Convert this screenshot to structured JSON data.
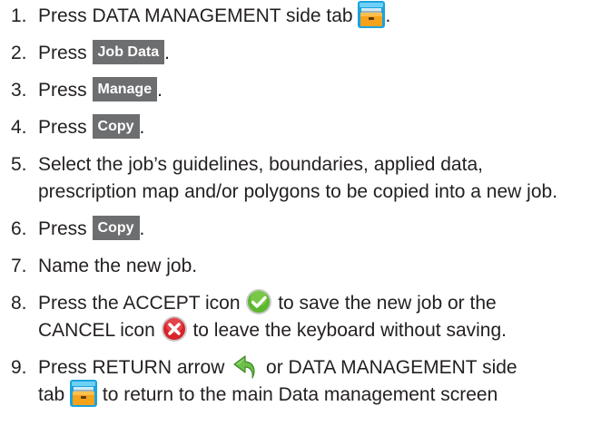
{
  "steps": [
    {
      "num": "1.",
      "before": "Press DATA MANAGEMENT side tab ",
      "after": "."
    },
    {
      "num": "2.",
      "before": "Press ",
      "button": "Job Data",
      "after": "."
    },
    {
      "num": "3.",
      "before": "Press ",
      "button": "Manage",
      "after": "."
    },
    {
      "num": "4.",
      "before": "Press ",
      "button": "Copy",
      "after": "."
    },
    {
      "num": "5.",
      "line1": "Select the job’s guidelines, boundaries, applied data,",
      "line2": "prescription map and/or polygons to be copied into a new job."
    },
    {
      "num": "6.",
      "before": "Press ",
      "button": "Copy",
      "after": "."
    },
    {
      "num": "7.",
      "text": "Name the new job."
    },
    {
      "num": "8.",
      "l1_before": "Press the ACCEPT icon ",
      "l1_after": " to save the new job or the",
      "l2_before": "CANCEL icon ",
      "l2_after": " to leave the keyboard without saving."
    },
    {
      "num": "9.",
      "l1_before": "Press RETURN arrow ",
      "l1_after": " or DATA MANAGEMENT side",
      "l2_before": "tab ",
      "l2_after": " to return to the main Data management screen"
    }
  ],
  "icons": {
    "data_management": "data-management-tab-icon",
    "accept": "accept-check-icon",
    "cancel": "cancel-x-icon",
    "return": "return-arrow-icon"
  },
  "colors": {
    "button_bg": "#6d6e70",
    "accept_green": "#5cb82e",
    "cancel_red": "#d8232a",
    "return_green": "#6cc04a",
    "tab_blue": "#1aa3dd",
    "tab_orange": "#f7a21b"
  }
}
